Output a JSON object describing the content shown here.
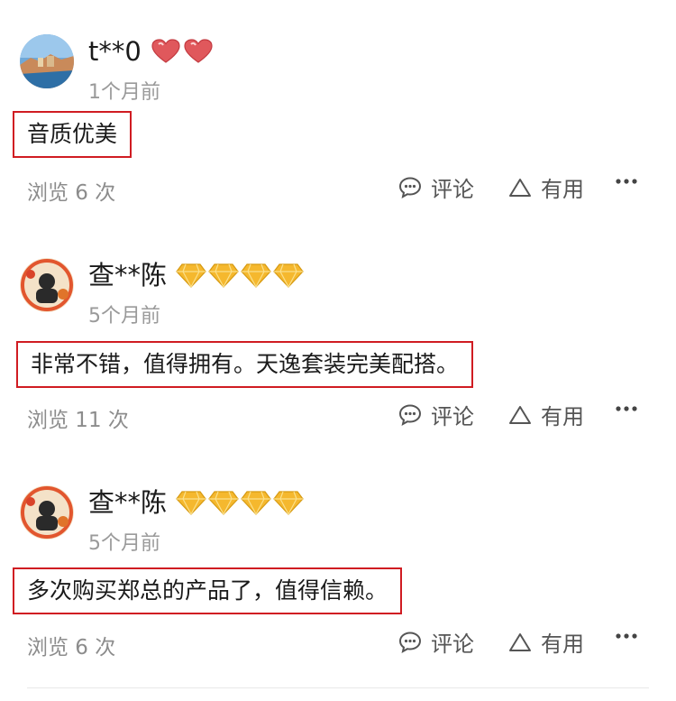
{
  "reviews": [
    {
      "username": "t**0",
      "badge_type": "heart",
      "badge_count": 2,
      "time": "1个月前",
      "content": "音质优美",
      "views": "浏览 6 次",
      "comment_label": "评论",
      "useful_label": "有用"
    },
    {
      "username": "查**陈",
      "badge_type": "diamond",
      "badge_count": 4,
      "time": "5个月前",
      "content": "非常不错，值得拥有。天逸套装完美配搭。",
      "views": "浏览 11 次",
      "comment_label": "评论",
      "useful_label": "有用"
    },
    {
      "username": "查**陈",
      "badge_type": "diamond",
      "badge_count": 4,
      "time": "5个月前",
      "content": "多次购买郑总的产品了，值得信赖。",
      "views": "浏览 6 次",
      "comment_label": "评论",
      "useful_label": "有用"
    }
  ],
  "colors": {
    "highlight_border": "#d01c22",
    "muted_text": "#9a9a9a",
    "diamond_gold": "#f5b82e",
    "heart_red": "#e0585c"
  }
}
